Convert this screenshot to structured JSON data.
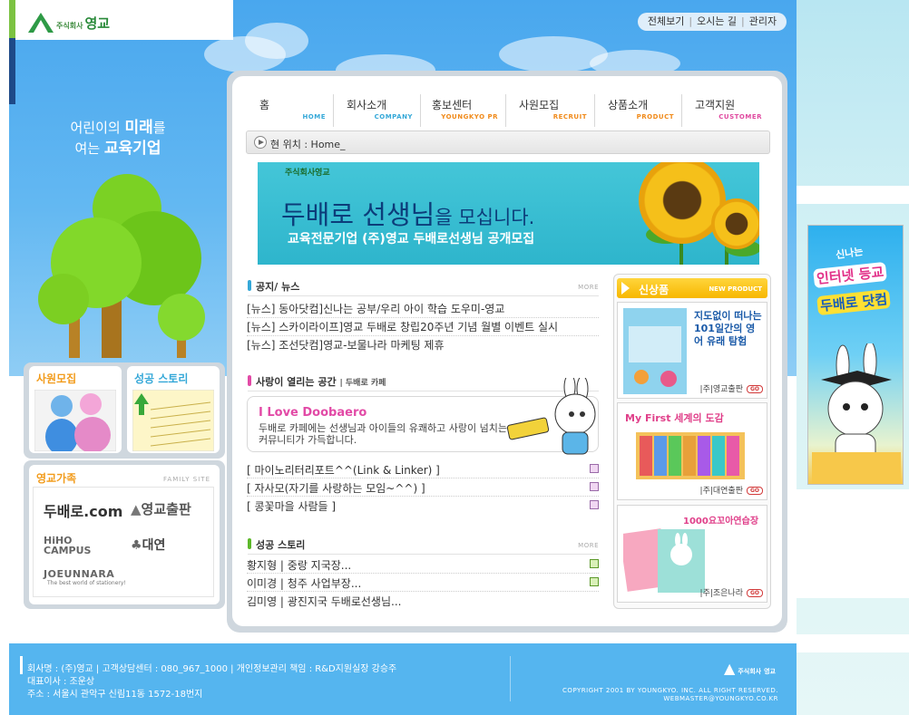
{
  "header": {
    "logo_small": "주식회사",
    "logo_main": "영교",
    "top_links": [
      "전체보기",
      "오시는 길",
      "관리자"
    ]
  },
  "slogan": {
    "line1_a": "어린이의 ",
    "line1_b": "미래",
    "line1_c": "를",
    "line2_a": "여는 ",
    "line2_b": "교육기업"
  },
  "nav": [
    {
      "ko": "홈",
      "en": "HOME",
      "color": "#35a8d8"
    },
    {
      "ko": "회사소개",
      "en": "COMPANY",
      "color": "#35a8d8"
    },
    {
      "ko": "홍보센터",
      "en": "YOUNGKYO PR",
      "color": "#f08a1a"
    },
    {
      "ko": "사원모집",
      "en": "RECRUIT",
      "color": "#f08a1a"
    },
    {
      "ko": "상품소개",
      "en": "PRODUCT",
      "color": "#f08a1a"
    },
    {
      "ko": "고객지원",
      "en": "CUSTOMER",
      "color": "#e04aa0"
    }
  ],
  "location": {
    "label": "현 위치 : Home_"
  },
  "banner": {
    "logo": "주식회사영교",
    "title_a": "두배로 선생님",
    "title_b": "을 모십니다.",
    "subtitle": "교육전문기업 (주)영교 두배로선생님 공개모집"
  },
  "news": {
    "title": "공지/ 뉴스",
    "more": "MORE",
    "items": [
      "[뉴스] 동아닷컴]신나는 공부/우리 아이 학습 도우미-영교",
      "[뉴스] 스카이라이프]영교 두배로 창립20주년 기념 월별 이벤트 실시",
      "[뉴스] 조선닷컴]영교-보물나라 마케팅 제휴"
    ]
  },
  "cafe": {
    "title": "사랑이 열리는 공간",
    "subtitle": "| 두배로 카페",
    "box_title": "I Love Doobaero",
    "box_desc": "두배로 카페에는 선생님과 아이들의 유쾌하고 사랑이 넘치는 커뮤니티가 가득합니다.",
    "links": [
      "[ 마이노리터리포트^^(Link & Linker) ]",
      "[ 자사모(자기를 사랑하는 모임~^^) ]",
      "[ 콩꽃마을 사람들 ]"
    ]
  },
  "success": {
    "title": "성공 스토리",
    "more": "MORE",
    "items": [
      "황지형 | 중랑 지국장...",
      "이미경 | 청주 사업부장...",
      "김미영 | 광진지국 두배로선생님..."
    ]
  },
  "new_products": {
    "title": "신상품",
    "title_en": "NEW PRODUCT",
    "go": "GO",
    "items": [
      {
        "desc": "지도없이 떠나는 101일간의 영어 유래 탐험",
        "publisher": "|주|영교출판"
      },
      {
        "desc": "My First 세계의 도감",
        "publisher": "|주|대연출판"
      },
      {
        "desc": "1000요꼬아연습장",
        "publisher": "|주|조은나라"
      }
    ]
  },
  "left": {
    "recruit": "사원모집",
    "story": "성공 스토리",
    "family_title": "영교가족",
    "family_en": "FAMILY SITE",
    "family_sites": [
      "두배로.com",
      "영교출판",
      "HiHO CAMPUS",
      "대연",
      "JOEUNNARA"
    ],
    "family_tagline": "The best world of stationery!"
  },
  "ad": {
    "line1": "신나는",
    "line2": "인터넷 등교",
    "line3": "두배로 닷컴"
  },
  "footer": {
    "line1": "회사명 : (주)영교 | 고객상담센터 : 080_967_1000 | 개인정보관리 책임 : R&D지원실장 강승주",
    "line2": "대표이사 : 조운상",
    "line3": "주소 : 서울시 관악구 신림11동 1572-18번지",
    "logo_small": "주식회사",
    "logo_main": "영교",
    "copyright": "COPYRIGHT 2001 BY YOUNGKYO. INC. ALL RIGHT RESERVED.",
    "email": "WEBMASTER@YOUNGKYO.CO.KR"
  }
}
